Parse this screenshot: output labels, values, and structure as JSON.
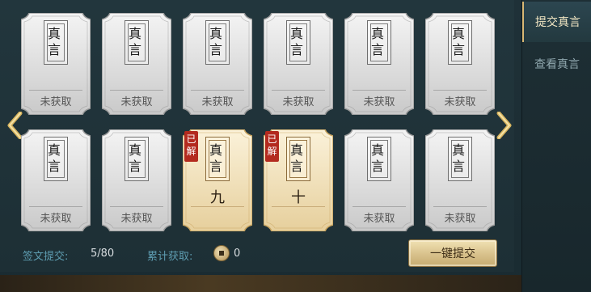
{
  "sidebar": {
    "tabs": [
      {
        "label": "提交真言",
        "active": true
      },
      {
        "label": "查看真言",
        "active": false
      }
    ]
  },
  "cards": [
    {
      "title": "真言",
      "status": "locked",
      "label": "未获取"
    },
    {
      "title": "真言",
      "status": "locked",
      "label": "未获取"
    },
    {
      "title": "真言",
      "status": "locked",
      "label": "未获取"
    },
    {
      "title": "真言",
      "status": "locked",
      "label": "未获取"
    },
    {
      "title": "真言",
      "status": "locked",
      "label": "未获取"
    },
    {
      "title": "真言",
      "status": "locked",
      "label": "未获取"
    },
    {
      "title": "真言",
      "status": "locked",
      "label": "未获取"
    },
    {
      "title": "真言",
      "status": "locked",
      "label": "未获取"
    },
    {
      "title": "真言",
      "status": "unlocked",
      "badge": "已解",
      "number": "九"
    },
    {
      "title": "真言",
      "status": "unlocked",
      "badge": "已解",
      "number": "十"
    },
    {
      "title": "真言",
      "status": "locked",
      "label": "未获取"
    },
    {
      "title": "真言",
      "status": "locked",
      "label": "未获取"
    }
  ],
  "footer": {
    "submit_label": "签文提交:",
    "submit_value": "5/80",
    "accum_label": "累计获取:",
    "accum_value": "0",
    "button_label": "一键提交"
  },
  "nav": {
    "left_icon": "chevron-left-icon",
    "right_icon": "chevron-right-icon",
    "coin_icon": "coin-icon"
  },
  "colors": {
    "accent_gold": "#d9b874",
    "badge_red": "#b32a1e",
    "label_blue": "#5e9db1"
  }
}
